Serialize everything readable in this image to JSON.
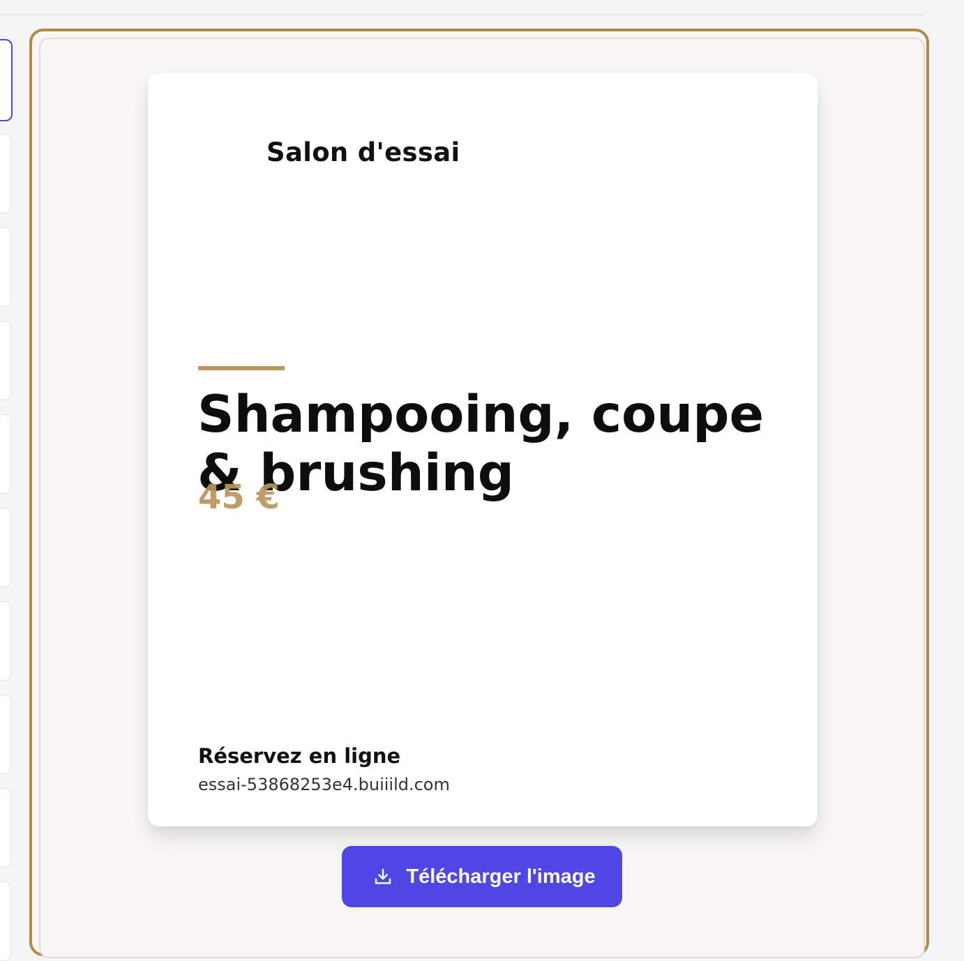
{
  "colors": {
    "accent_gold": "#b8965d",
    "frame_border": "#b08a4a",
    "primary_button": "#4f46e5"
  },
  "poster": {
    "salon_name": "Salon d'essai",
    "service_title": "Shampooing, coupe & brushing",
    "price": "45 €",
    "book_label": "Réservez en ligne",
    "book_url": "essai-53868253e4.buiiild.com"
  },
  "actions": {
    "download_label": "Télécharger l'image",
    "download_icon": "download-icon"
  }
}
